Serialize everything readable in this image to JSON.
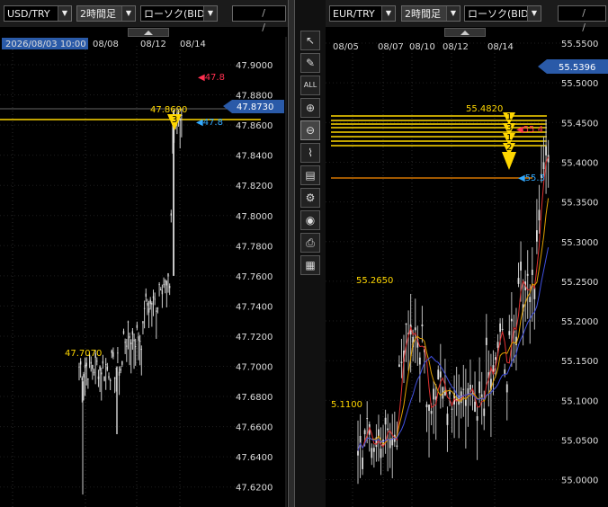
{
  "left": {
    "pair": "USD/TRY",
    "timeframe": "2時間足",
    "chart_type": "ローソク(BID)",
    "date_placeholder": "/ /",
    "date_labels": [
      {
        "text": "2026/08/03 10:00",
        "highlight": true
      },
      {
        "text": "08/08",
        "highlight": false
      },
      {
        "text": "08/12",
        "highlight": false
      },
      {
        "text": "08/14",
        "highlight": false
      }
    ],
    "price_ticks": [
      "47.9000",
      "47.8800",
      "47.8600",
      "47.8400",
      "47.8200",
      "47.8000",
      "47.7800",
      "47.7600",
      "47.7400",
      "47.7200",
      "47.7000",
      "47.6800",
      "47.6600",
      "47.6400",
      "47.6200"
    ],
    "current_price": "47.8730",
    "high_label": "47.8690",
    "low_label": "47.7070",
    "marker_red": "47.8",
    "marker_blue": "47.8",
    "marker_number": "3"
  },
  "right": {
    "pair": "EUR/TRY",
    "timeframe": "2時間足",
    "chart_type": "ローソク(BID)",
    "date_placeholder": "/ /",
    "date_labels": [
      {
        "text": "08/05",
        "highlight": false
      },
      {
        "text": "08/07",
        "highlight": false
      },
      {
        "text": "08/10",
        "highlight": false
      },
      {
        "text": "08/12",
        "highlight": false
      },
      {
        "text": "08/14",
        "highlight": false
      }
    ],
    "price_ticks": [
      "55.5500",
      "55.5000",
      "55.4500",
      "55.4000",
      "55.3500",
      "55.3000",
      "55.2500",
      "55.2000",
      "55.1500",
      "55.1000",
      "55.0500",
      "55.0000"
    ],
    "current_price": "55.5396",
    "high_label": "55.4820",
    "mid_label": "55.2650",
    "low_label": "5.1100",
    "marker_red": "55.4",
    "marker_blue": "55.3",
    "marker_numbers": [
      "1",
      "3",
      "1",
      "2"
    ]
  },
  "toolbar": {
    "tools": [
      {
        "name": "cursor-tool-icon",
        "glyph": "↖",
        "active": false
      },
      {
        "name": "pen-tool-icon",
        "glyph": "✎",
        "active": false
      },
      {
        "name": "all-erase-tool-icon",
        "glyph": "ALL",
        "active": false
      },
      {
        "name": "zoom-in-icon",
        "glyph": "⊕",
        "active": false
      },
      {
        "name": "zoom-out-icon",
        "glyph": "⊖",
        "active": true
      },
      {
        "name": "technical-indicator-icon",
        "glyph": "⌇",
        "active": false
      },
      {
        "name": "price-table-icon",
        "glyph": "▤",
        "active": false
      },
      {
        "name": "settings-symbols-icon",
        "glyph": "⚙",
        "active": false
      },
      {
        "name": "eye-icon",
        "glyph": "◉",
        "active": false
      },
      {
        "name": "print-icon",
        "glyph": "⎙",
        "active": false
      },
      {
        "name": "grid-table-icon",
        "glyph": "▦",
        "active": false
      }
    ]
  },
  "colors": {
    "accent_yellow": "#ffd700",
    "orange_line": "#ff8c00",
    "current_price_bg": "#2a5aa8",
    "red_marker": "#ff3050",
    "blue_marker": "#33aaff"
  }
}
